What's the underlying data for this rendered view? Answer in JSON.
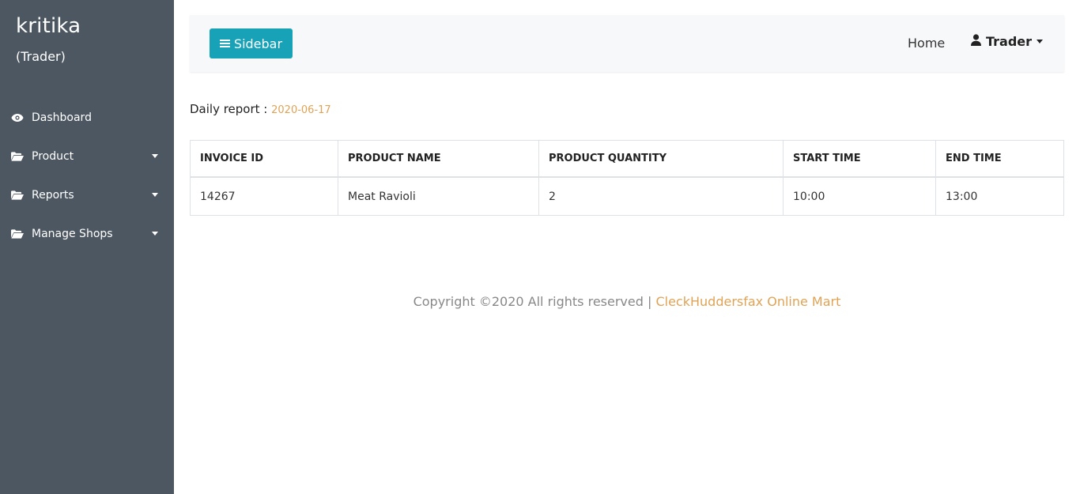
{
  "sidebar": {
    "user_name": "kritika",
    "user_role": "(Trader)",
    "items": [
      {
        "label": "Dashboard",
        "icon": "eye-icon"
      },
      {
        "label": "Product",
        "icon": "folder-open-icon"
      },
      {
        "label": "Reports",
        "icon": "folder-open-icon"
      },
      {
        "label": "Manage Shops",
        "icon": "folder-open-icon"
      }
    ]
  },
  "topbar": {
    "sidebar_button_label": "Sidebar",
    "home_label": "Home",
    "user_menu_label": "Trader"
  },
  "report": {
    "title": "Daily report :",
    "date": "2020-06-17",
    "columns": [
      "INVOICE ID",
      "PRODUCT NAME",
      "PRODUCT QUANTITY",
      "START TIME",
      "END TIME"
    ],
    "rows": [
      [
        "14267",
        "Meat Ravioli",
        "2",
        "10:00",
        "13:00"
      ]
    ]
  },
  "footer": {
    "text": "Copyright ©2020 All rights reserved |",
    "brand": "CleckHuddersfax Online Mart"
  },
  "colors": {
    "sidebar_bg": "#4d5761",
    "accent": "#17a2b8",
    "highlight": "#e0a355"
  }
}
